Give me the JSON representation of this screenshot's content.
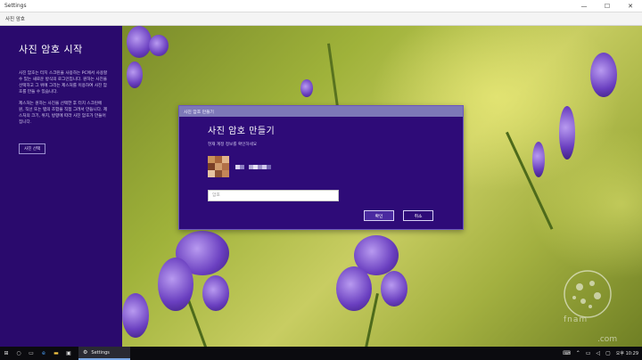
{
  "window": {
    "title": "Settings",
    "controls": {
      "minimize": "—",
      "maximize": "☐",
      "close": "✕"
    }
  },
  "app": {
    "subtitle": "사진 암호"
  },
  "left_panel": {
    "heading": "사진 암호 시작",
    "paragraph1": "사진 암호는 터치 스크린을 사용하는 PC에서 사용할 수 있는 새로운 방식의 로그인입니다. 원하는 사진을 선택하고 그 위에 그리는 제스처를 이용하여 사진 암호를 만들 수 있습니다.",
    "paragraph2": "제스처는 원하는 사진을 선택한 후 터치 스크린에 원, 직선 또는 탭의 조합을 직접 그려서 만듭니다. 제스처의 크기, 위치, 방향에 따라 사진 암호가 만들어집니다.",
    "choose_picture_label": "사진 선택"
  },
  "dialog": {
    "title": "사진 암호 만들기",
    "heading": "사진 암호 만들기",
    "instruction": "현재 계정 정보를 확인하세요",
    "password_placeholder": "암호",
    "ok_label": "확인",
    "cancel_label": "취소"
  },
  "watermark": {
    "text": "fnam",
    "suffix": ".com"
  },
  "taskbar": {
    "app_label": "Settings",
    "clock": "오후 10:29",
    "icons": [
      "start-icon",
      "search-icon",
      "task-view-icon",
      "edge-icon",
      "file-explorer-icon",
      "store-icon"
    ]
  },
  "colors": {
    "panel_purple": "#2a0a6d",
    "dialog_purple": "#2e0b78",
    "dialog_title": "#7d78b8"
  }
}
